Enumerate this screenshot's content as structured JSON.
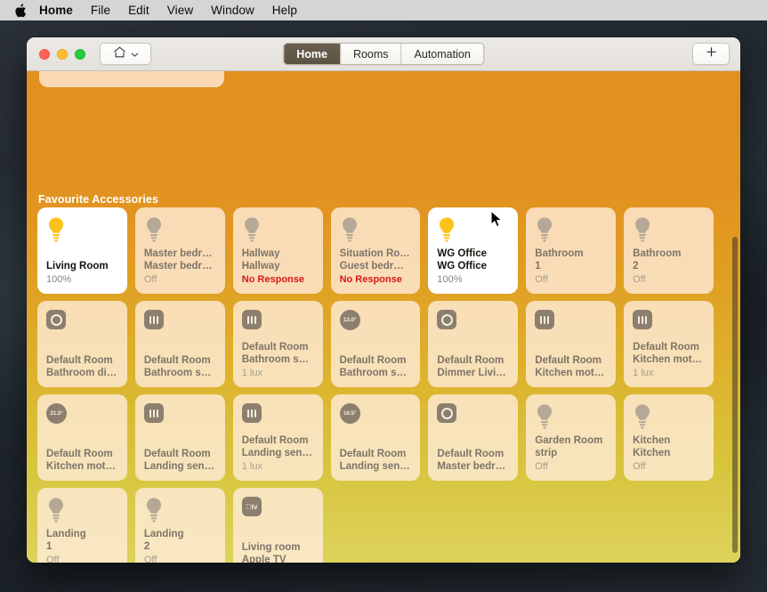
{
  "menubar": {
    "apple_icon": "apple-logo-icon",
    "items": [
      {
        "label": "Home",
        "bold": true
      },
      {
        "label": "File"
      },
      {
        "label": "Edit"
      },
      {
        "label": "View"
      },
      {
        "label": "Window"
      },
      {
        "label": "Help"
      }
    ]
  },
  "window": {
    "traffic_lights": [
      "close",
      "minimize",
      "zoom"
    ],
    "home_picker": {
      "icon": "house-icon",
      "chevron": "chevron-down-icon"
    },
    "tabs": [
      {
        "label": "Home",
        "selected": true
      },
      {
        "label": "Rooms",
        "selected": false
      },
      {
        "label": "Automation",
        "selected": false
      }
    ],
    "add_button": {
      "label": "+",
      "icon": "plus-icon"
    }
  },
  "colors": {
    "gradient_top": "#e2901f",
    "gradient_bottom": "#ddd25c",
    "tab_selected_bg": "#5d5344",
    "error_text": "#d8191c",
    "bulb_on": "#fcc21b",
    "bulb_off": "#b5a896",
    "glyph_bg": "#8c7f6d"
  },
  "content": {
    "section_title": "Favourite Accessories",
    "rows": [
      [
        {
          "icon": "lightbulb-icon",
          "state": "on",
          "line1": "Living Room",
          "line2": "",
          "status": "100%"
        },
        {
          "icon": "lightbulb-icon",
          "state": "off",
          "line1": "Master bedr…",
          "line2": "Master bedr…",
          "status": "Off"
        },
        {
          "icon": "lightbulb-icon",
          "state": "off",
          "line1": "Hallway",
          "line2": "Hallway",
          "status": "No Response",
          "status_type": "error"
        },
        {
          "icon": "lightbulb-icon",
          "state": "off",
          "line1": "Situation Ro…",
          "line2": "Guest bedr…",
          "status": "No Response",
          "status_type": "error"
        },
        {
          "icon": "lightbulb-icon",
          "state": "on",
          "line1": "WG Office",
          "line2": "WG Office",
          "status": "100%"
        },
        {
          "icon": "lightbulb-icon",
          "state": "off",
          "line1": "Bathroom",
          "line2": "1",
          "status": "Off"
        },
        {
          "icon": "lightbulb-icon",
          "state": "off",
          "line1": "Bathroom",
          "line2": "2",
          "status": "Off"
        }
      ],
      [
        {
          "icon": "dimmer-icon",
          "state": "off",
          "line1": "Default Room",
          "line2": "Bathroom di…",
          "status": ""
        },
        {
          "icon": "sensor-icon",
          "state": "off",
          "line1": "Default Room",
          "line2": "Bathroom s…",
          "status": ""
        },
        {
          "icon": "sensor-icon",
          "state": "off",
          "line1": "Default Room",
          "line2": "Bathroom s…",
          "status": "1 lux"
        },
        {
          "icon": "temperature-icon",
          "temp": "13.0°",
          "state": "off",
          "line1": "Default Room",
          "line2": "Bathroom s…",
          "status": ""
        },
        {
          "icon": "dimmer-icon",
          "state": "off",
          "line1": "Default Room",
          "line2": "Dimmer Livi…",
          "status": ""
        },
        {
          "icon": "sensor-icon",
          "state": "off",
          "line1": "Default Room",
          "line2": "Kitchen mot…",
          "status": ""
        },
        {
          "icon": "sensor-icon",
          "state": "off",
          "line1": "Default Room",
          "line2": "Kitchen mot…",
          "status": "1 lux"
        }
      ],
      [
        {
          "icon": "temperature-icon",
          "temp": "21.0°",
          "state": "off",
          "line1": "Default Room",
          "line2": "Kitchen mot…",
          "status": ""
        },
        {
          "icon": "sensor-icon",
          "state": "off",
          "line1": "Default Room",
          "line2": "Landing sen…",
          "status": ""
        },
        {
          "icon": "sensor-icon",
          "state": "off",
          "line1": "Default Room",
          "line2": "Landing sen…",
          "status": "1 lux"
        },
        {
          "icon": "temperature-icon",
          "temp": "16.5°",
          "state": "off",
          "line1": "Default Room",
          "line2": "Landing sen…",
          "status": ""
        },
        {
          "icon": "dimmer-icon",
          "state": "off",
          "line1": "Default Room",
          "line2": "Master bedr…",
          "status": ""
        },
        {
          "icon": "lightbulb-icon",
          "state": "off",
          "line1": "Garden Room",
          "line2": "strip",
          "status": "Off"
        },
        {
          "icon": "lightbulb-icon",
          "state": "off",
          "line1": "Kitchen",
          "line2": "Kitchen",
          "status": "Off"
        }
      ],
      [
        {
          "icon": "lightbulb-icon",
          "state": "off",
          "line1": "Landing",
          "line2": "1",
          "status": "Off"
        },
        {
          "icon": "lightbulb-icon",
          "state": "off",
          "line1": "Landing",
          "line2": "2",
          "status": "Off"
        },
        {
          "icon": "appletv-icon",
          "state": "off",
          "line1": "Living room",
          "line2": "Apple TV",
          "status": "",
          "glyph_label": "tv"
        }
      ]
    ]
  }
}
